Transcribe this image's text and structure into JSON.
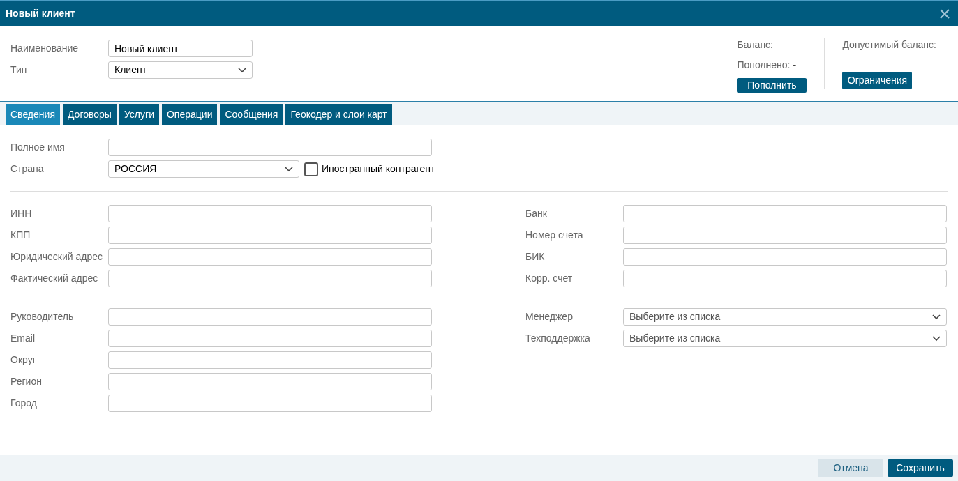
{
  "window": {
    "title": "Новый клиент"
  },
  "header": {
    "name": {
      "label": "Наименование",
      "value": "Новый клиент"
    },
    "type": {
      "label": "Тип",
      "value": "Клиент"
    }
  },
  "balance": {
    "balance_label": "Баланс:",
    "replenished_label": "Пополнено:",
    "replenished_value": "-",
    "topup_button": "Пополнить",
    "allowed_label": "Допустимый баланс:",
    "limits_button": "Ограничения"
  },
  "tabs": [
    {
      "label": "Сведения",
      "selected": true
    },
    {
      "label": "Договоры",
      "selected": false
    },
    {
      "label": "Услуги",
      "selected": false
    },
    {
      "label": "Операции",
      "selected": false
    },
    {
      "label": "Сообщения",
      "selected": false
    },
    {
      "label": "Геокодер и слои карт",
      "selected": false
    }
  ],
  "general": {
    "full_name": {
      "label": "Полное имя"
    },
    "country": {
      "label": "Страна",
      "value": "РОССИЯ"
    },
    "foreign": {
      "label": "Иностранный контрагент",
      "checked": false
    }
  },
  "requisites_left": [
    {
      "label": "ИНН"
    },
    {
      "label": "КПП"
    },
    {
      "label": "Юридический адрес"
    },
    {
      "label": "Фактический адрес"
    }
  ],
  "requisites_right": [
    {
      "label": "Банк"
    },
    {
      "label": "Номер счета"
    },
    {
      "label": "БИК"
    },
    {
      "label": "Корр. счет"
    }
  ],
  "contacts_left": [
    {
      "label": "Руководитель"
    },
    {
      "label": "Email"
    },
    {
      "label": "Округ"
    },
    {
      "label": "Регион"
    },
    {
      "label": "Город"
    }
  ],
  "contacts_right": [
    {
      "label": "Менеджер",
      "placeholder": "Выберите из списка"
    },
    {
      "label": "Техподдержка",
      "placeholder": "Выберите из списка"
    }
  ],
  "footer": {
    "cancel": "Отмена",
    "save": "Сохранить"
  }
}
